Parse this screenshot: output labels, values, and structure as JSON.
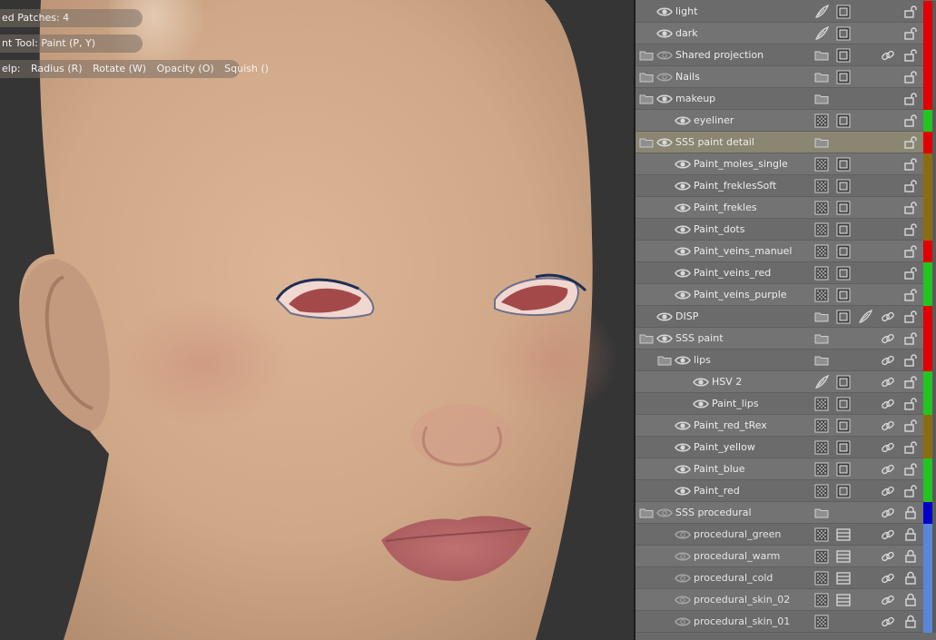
{
  "viewport": {
    "hud": {
      "patches": "ed Patches: 4",
      "tool": "nt Tool: Paint (P, Y)",
      "help_prefix": "elp:",
      "radius": "Radius (R)",
      "rotate": "Rotate (W)",
      "opacity": "Opacity (O)",
      "squish": "Squish ()"
    }
  },
  "colors": {
    "red": "#e00000",
    "green": "#22c422",
    "olive": "#8a6d12",
    "blue": "#0000c8",
    "lightblue": "#5a86d8",
    "selected": "#8a8672"
  },
  "layers": [
    {
      "label": "light",
      "indent": 0,
      "folder": false,
      "eye": "open",
      "icons": [
        "feather-icon",
        "mask-icon"
      ],
      "link": false,
      "lock": "open",
      "color": "red"
    },
    {
      "label": "dark",
      "indent": 0,
      "folder": false,
      "eye": "open",
      "icons": [
        "feather-icon",
        "mask-icon"
      ],
      "link": false,
      "lock": "open",
      "color": "red"
    },
    {
      "label": "Shared projection",
      "indent": 0,
      "folder": true,
      "eye": "closed",
      "icons": [
        "folder-icon",
        "mask-icon"
      ],
      "link": true,
      "lock": "open",
      "color": "red"
    },
    {
      "label": "Nails",
      "indent": 0,
      "folder": true,
      "eye": "closed",
      "icons": [
        "folder-icon",
        "mask-icon"
      ],
      "link": false,
      "lock": "open",
      "color": "red"
    },
    {
      "label": "makeup",
      "indent": 0,
      "folder": true,
      "eye": "open",
      "icons": [
        "folder-icon"
      ],
      "link": false,
      "lock": "open",
      "color": "red"
    },
    {
      "label": "eyeliner",
      "indent": 1,
      "folder": false,
      "eye": "open",
      "icons": [
        "texture-icon",
        "mask-icon"
      ],
      "link": false,
      "lock": "open",
      "color": "green"
    },
    {
      "label": "SSS paint detail",
      "indent": 0,
      "folder": true,
      "eye": "open",
      "icons": [
        "folder-icon"
      ],
      "link": false,
      "lock": "open",
      "color": "red",
      "selected": true
    },
    {
      "label": "Paint_moles_single",
      "indent": 1,
      "folder": false,
      "eye": "open",
      "icons": [
        "texture-icon",
        "mask-icon"
      ],
      "link": false,
      "lock": "open",
      "color": "olive"
    },
    {
      "label": "Paint_freklesSoft",
      "indent": 1,
      "folder": false,
      "eye": "open",
      "icons": [
        "texture-icon",
        "mask-icon"
      ],
      "link": false,
      "lock": "open",
      "color": "olive"
    },
    {
      "label": "Paint_frekles",
      "indent": 1,
      "folder": false,
      "eye": "open",
      "icons": [
        "texture-icon",
        "mask-icon"
      ],
      "link": false,
      "lock": "open",
      "color": "olive"
    },
    {
      "label": "Paint_dots",
      "indent": 1,
      "folder": false,
      "eye": "open",
      "icons": [
        "texture-icon",
        "mask-icon"
      ],
      "link": false,
      "lock": "open",
      "color": "olive"
    },
    {
      "label": "Paint_veins_manuel",
      "indent": 1,
      "folder": false,
      "eye": "open",
      "icons": [
        "texture-icon",
        "mask-icon"
      ],
      "link": false,
      "lock": "open",
      "color": "red"
    },
    {
      "label": "Paint_veins_red",
      "indent": 1,
      "folder": false,
      "eye": "open",
      "icons": [
        "texture-icon",
        "mask-icon"
      ],
      "link": false,
      "lock": "open",
      "color": "green"
    },
    {
      "label": "Paint_veins_purple",
      "indent": 1,
      "folder": false,
      "eye": "open",
      "icons": [
        "texture-icon",
        "mask-icon"
      ],
      "link": false,
      "lock": "open",
      "color": "green"
    },
    {
      "label": "DISP",
      "indent": 0,
      "folder": false,
      "eye": "open",
      "icons": [
        "folder-icon",
        "mask-icon",
        "feather-icon"
      ],
      "link": true,
      "lock": "open",
      "color": "red"
    },
    {
      "label": "SSS paint",
      "indent": 0,
      "folder": true,
      "eye": "open",
      "icons": [
        "folder-icon"
      ],
      "link": true,
      "lock": "open",
      "color": "red"
    },
    {
      "label": "lips",
      "indent": 1,
      "folder": true,
      "eye": "open",
      "icons": [
        "folder-icon"
      ],
      "link": true,
      "lock": "open",
      "color": "red"
    },
    {
      "label": "HSV 2",
      "indent": 2,
      "folder": false,
      "eye": "open",
      "icons": [
        "feather-icon",
        "mask-icon"
      ],
      "link": true,
      "lock": "open",
      "color": "green"
    },
    {
      "label": "Paint_lips",
      "indent": 2,
      "folder": false,
      "eye": "open",
      "icons": [
        "texture-icon",
        "mask-icon"
      ],
      "link": true,
      "lock": "open",
      "color": "green"
    },
    {
      "label": "Paint_red_tRex",
      "indent": 1,
      "folder": false,
      "eye": "open",
      "icons": [
        "texture-icon",
        "mask-icon"
      ],
      "link": true,
      "lock": "open",
      "color": "olive"
    },
    {
      "label": "Paint_yellow",
      "indent": 1,
      "folder": false,
      "eye": "open",
      "icons": [
        "texture-icon",
        "mask-icon"
      ],
      "link": true,
      "lock": "open",
      "color": "olive"
    },
    {
      "label": "Paint_blue",
      "indent": 1,
      "folder": false,
      "eye": "open",
      "icons": [
        "texture-icon",
        "mask-icon"
      ],
      "link": true,
      "lock": "open",
      "color": "green"
    },
    {
      "label": "Paint_red",
      "indent": 1,
      "folder": false,
      "eye": "open",
      "icons": [
        "texture-icon",
        "mask-icon"
      ],
      "link": true,
      "lock": "open",
      "color": "green"
    },
    {
      "label": "SSS procedural",
      "indent": 0,
      "folder": true,
      "eye": "closed",
      "icons": [
        "folder-icon"
      ],
      "link": true,
      "lock": "closed",
      "color": "blue"
    },
    {
      "label": "procedural_green",
      "indent": 1,
      "folder": false,
      "eye": "closed",
      "icons": [
        "texture-icon",
        "list-icon"
      ],
      "link": true,
      "lock": "closed",
      "color": "lightblue"
    },
    {
      "label": "procedural_warm",
      "indent": 1,
      "folder": false,
      "eye": "closed",
      "icons": [
        "texture-icon",
        "list-icon"
      ],
      "link": true,
      "lock": "closed",
      "color": "lightblue"
    },
    {
      "label": "procedural_cold",
      "indent": 1,
      "folder": false,
      "eye": "closed",
      "icons": [
        "texture-icon",
        "list-icon"
      ],
      "link": true,
      "lock": "closed",
      "color": "lightblue"
    },
    {
      "label": "procedural_skin_02",
      "indent": 1,
      "folder": false,
      "eye": "closed",
      "icons": [
        "texture-icon",
        "list-icon"
      ],
      "link": true,
      "lock": "closed",
      "color": "lightblue"
    },
    {
      "label": "procedural_skin_01",
      "indent": 1,
      "folder": false,
      "eye": "closed",
      "icons": [
        "texture-icon"
      ],
      "link": true,
      "lock": "closed",
      "color": "lightblue"
    }
  ]
}
